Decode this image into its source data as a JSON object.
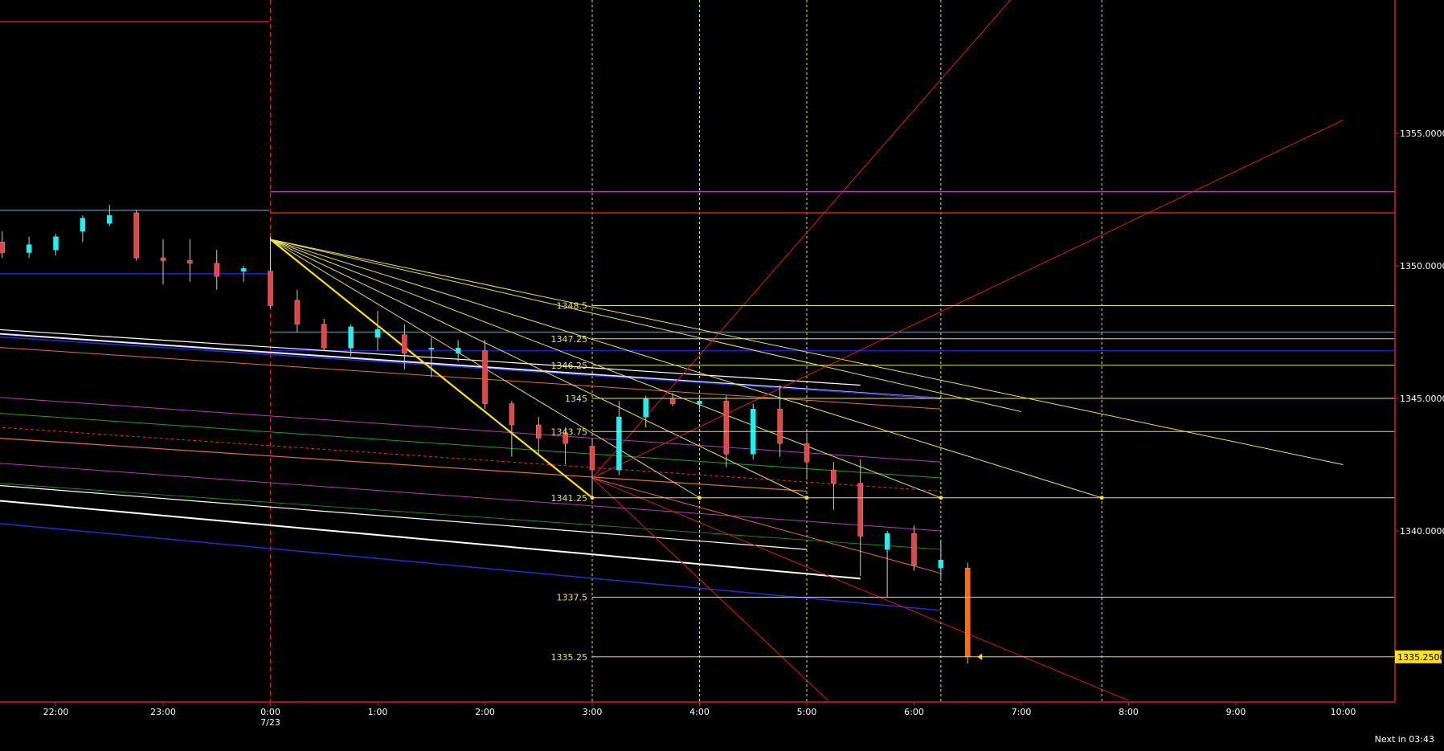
{
  "status": {
    "next_bar": "Next in 03:43"
  },
  "chart_data": {
    "type": "candlestick",
    "x_ticks": [
      "22:00",
      "23:00",
      "0:00",
      "1:00",
      "2:00",
      "3:00",
      "4:00",
      "5:00",
      "6:00",
      "7:00",
      "8:00",
      "9:00",
      "10:00"
    ],
    "date_label": {
      "at": "0:00",
      "text": "7/23"
    },
    "y_ticks": [
      "1355.0000",
      "1350.0000",
      "1345.0000",
      "1340.0000"
    ],
    "ylim": [
      1333.6,
      1360
    ],
    "current_price": "1335.2500",
    "price_levels": [
      {
        "label": "1348.5",
        "value": 1348.5
      },
      {
        "label": "1347.25",
        "value": 1347.25
      },
      {
        "label": "1346.25",
        "value": 1346.25
      },
      {
        "label": "1345",
        "value": 1345.0
      },
      {
        "label": "1343.75",
        "value": 1343.75
      },
      {
        "label": "1341.25",
        "value": 1341.25
      },
      {
        "label": "1337.5",
        "value": 1337.5
      },
      {
        "label": "1335.25",
        "value": 1335.25
      }
    ],
    "horizontal_lines": [
      {
        "value": 1352.8,
        "color": "#b040b0"
      },
      {
        "value": 1352.0,
        "color": "#d02020"
      },
      {
        "value": 1347.5,
        "color": "#2a8a8a"
      },
      {
        "value": 1346.8,
        "color": "#2020d0"
      }
    ],
    "candles": [
      {
        "t": 21.5,
        "o": 1350.9,
        "h": 1351.3,
        "l": 1350.3,
        "c": 1350.5
      },
      {
        "t": 21.75,
        "o": 1350.5,
        "h": 1351.1,
        "l": 1350.3,
        "c": 1350.8
      },
      {
        "t": 22.0,
        "o": 1350.6,
        "h": 1351.2,
        "l": 1350.4,
        "c": 1351.1
      },
      {
        "t": 22.25,
        "o": 1351.3,
        "h": 1351.9,
        "l": 1350.9,
        "c": 1351.8
      },
      {
        "t": 22.5,
        "o": 1351.6,
        "h": 1352.3,
        "l": 1351.5,
        "c": 1351.9
      },
      {
        "t": 22.75,
        "o": 1352.0,
        "h": 1352.1,
        "l": 1350.2,
        "c": 1350.3
      },
      {
        "t": 23.0,
        "o": 1350.3,
        "h": 1351.0,
        "l": 1349.3,
        "c": 1350.2
      },
      {
        "t": 23.25,
        "o": 1350.2,
        "h": 1351.0,
        "l": 1349.4,
        "c": 1350.1
      },
      {
        "t": 23.5,
        "o": 1350.1,
        "h": 1350.6,
        "l": 1349.1,
        "c": 1349.6
      },
      {
        "t": 23.75,
        "o": 1349.8,
        "h": 1350.0,
        "l": 1349.4,
        "c": 1349.9
      },
      {
        "t": 24.0,
        "o": 1349.8,
        "h": 1351.1,
        "l": 1348.4,
        "c": 1348.5
      },
      {
        "t": 24.25,
        "o": 1348.7,
        "h": 1349.1,
        "l": 1347.5,
        "c": 1347.8
      },
      {
        "t": 24.5,
        "o": 1347.8,
        "h": 1348.0,
        "l": 1346.8,
        "c": 1346.9
      },
      {
        "t": 24.75,
        "o": 1346.9,
        "h": 1347.8,
        "l": 1346.6,
        "c": 1347.7
      },
      {
        "t": 25.0,
        "o": 1347.3,
        "h": 1348.3,
        "l": 1346.8,
        "c": 1347.6
      },
      {
        "t": 25.25,
        "o": 1347.4,
        "h": 1347.8,
        "l": 1346.1,
        "c": 1346.7
      },
      {
        "t": 25.5,
        "o": 1346.9,
        "h": 1347.3,
        "l": 1345.8,
        "c": 1346.9
      },
      {
        "t": 25.75,
        "o": 1346.7,
        "h": 1347.2,
        "l": 1346.4,
        "c": 1346.9
      },
      {
        "t": 26.0,
        "o": 1346.8,
        "h": 1347.2,
        "l": 1344.6,
        "c": 1344.8
      },
      {
        "t": 26.25,
        "o": 1344.8,
        "h": 1344.9,
        "l": 1342.8,
        "c": 1344.0
      },
      {
        "t": 26.5,
        "o": 1344.0,
        "h": 1344.3,
        "l": 1342.9,
        "c": 1343.5
      },
      {
        "t": 26.75,
        "o": 1343.7,
        "h": 1343.9,
        "l": 1342.5,
        "c": 1343.3
      },
      {
        "t": 27.0,
        "o": 1343.2,
        "h": 1343.4,
        "l": 1341.2,
        "c": 1342.3
      },
      {
        "t": 27.25,
        "o": 1342.3,
        "h": 1344.9,
        "l": 1342.1,
        "c": 1344.3
      },
      {
        "t": 27.5,
        "o": 1344.3,
        "h": 1345.1,
        "l": 1343.9,
        "c": 1345.0
      },
      {
        "t": 27.75,
        "o": 1345.0,
        "h": 1345.2,
        "l": 1344.7,
        "c": 1344.8
      },
      {
        "t": 28.0,
        "o": 1344.8,
        "h": 1345.0,
        "l": 1344.6,
        "c": 1344.9
      },
      {
        "t": 28.25,
        "o": 1344.9,
        "h": 1345.1,
        "l": 1342.4,
        "c": 1342.9
      },
      {
        "t": 28.5,
        "o": 1342.9,
        "h": 1344.8,
        "l": 1342.7,
        "c": 1344.6
      },
      {
        "t": 28.75,
        "o": 1344.6,
        "h": 1345.5,
        "l": 1342.8,
        "c": 1343.3
      },
      {
        "t": 29.0,
        "o": 1343.3,
        "h": 1343.7,
        "l": 1342.0,
        "c": 1342.6
      },
      {
        "t": 29.25,
        "o": 1342.3,
        "h": 1342.6,
        "l": 1340.8,
        "c": 1341.8
      },
      {
        "t": 29.5,
        "o": 1341.8,
        "h": 1342.7,
        "l": 1338.3,
        "c": 1339.8
      },
      {
        "t": 29.75,
        "o": 1339.3,
        "h": 1340.0,
        "l": 1337.5,
        "c": 1339.9
      },
      {
        "t": 30.0,
        "o": 1339.9,
        "h": 1340.2,
        "l": 1338.5,
        "c": 1338.7
      },
      {
        "t": 30.25,
        "o": 1338.6,
        "h": 1339.6,
        "l": 1338.2,
        "c": 1338.9
      },
      {
        "t": 30.5,
        "o": 1338.6,
        "h": 1338.8,
        "l": 1335.0,
        "c": 1335.25
      }
    ]
  }
}
